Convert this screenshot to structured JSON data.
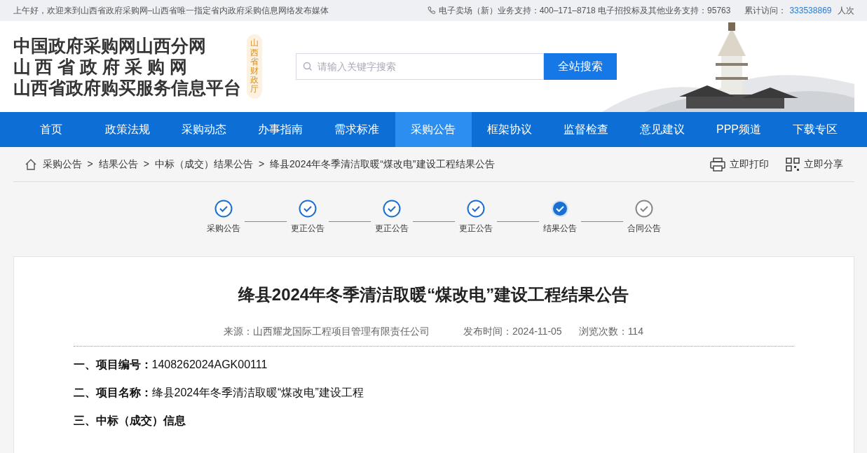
{
  "top_bar": {
    "welcome": "上午好，欢迎来到山西省政府采购网–山西省唯一指定省内政府采购信息网络发布媒体",
    "support": "电子卖场（新）业务支持：400–171–8718 电子招投标及其他业务支持：95763",
    "visits_label": "累计访问：",
    "visits_count": "333538869",
    "visits_unit": "人次"
  },
  "header": {
    "logo_lines": [
      "中国政府采购网山西分网",
      "山 西 省 政 府 采 购 网",
      "山西省政府购买服务信息平台"
    ],
    "seal": "山西省财政厅",
    "search": {
      "placeholder": "请输入关键字搜索",
      "button": "全站搜索"
    }
  },
  "nav": [
    {
      "label": "首页",
      "selected": false
    },
    {
      "label": "政策法规",
      "selected": false
    },
    {
      "label": "采购动态",
      "selected": false
    },
    {
      "label": "办事指南",
      "selected": false
    },
    {
      "label": "需求标准",
      "selected": false
    },
    {
      "label": "采购公告",
      "selected": true
    },
    {
      "label": "框架协议",
      "selected": false
    },
    {
      "label": "监督检查",
      "selected": false
    },
    {
      "label": "意见建议",
      "selected": false
    },
    {
      "label": "PPP频道",
      "selected": false
    },
    {
      "label": "下载专区",
      "selected": false
    }
  ],
  "breadcrumb": [
    {
      "label": "采购公告",
      "separator": ">"
    },
    {
      "label": "结果公告",
      "separator": ">"
    },
    {
      "label": "中标（成交）结果公告",
      "separator": ">"
    },
    {
      "label": "绛县2024年冬季清洁取暖“煤改电”建设工程结果公告"
    }
  ],
  "actions": [
    {
      "kind": "print",
      "label": "立即打印"
    },
    {
      "kind": "share",
      "label": "立即分享"
    }
  ],
  "steps": [
    {
      "label": "采购公告",
      "completed": true,
      "selected": false
    },
    {
      "label": "更正公告",
      "completed": true,
      "selected": false
    },
    {
      "label": "更正公告",
      "completed": true,
      "selected": false
    },
    {
      "label": "更正公告",
      "completed": true,
      "selected": false
    },
    {
      "label": "结果公告",
      "completed": true,
      "selected": true
    },
    {
      "label": "合同公告",
      "completed": false,
      "selected": false
    }
  ],
  "article": {
    "title": "绛县2024年冬季清洁取暖“煤改电”建设工程结果公告",
    "meta": [
      "来源：山西耀龙国际工程项目管理有限责任公司",
      "发布时间：2024-11-05",
      "浏览次数：114"
    ],
    "paragraphs": [
      {
        "kind": "field",
        "text": "**一、项目编号：**1408262024AGK00111"
      },
      {
        "kind": "field",
        "text": "**二、项目名称：**绛县2024年冬季清洁取暖“煤改电”建设工程"
      },
      {
        "kind": "heading",
        "text": "三、中标（成交）信息"
      }
    ]
  }
}
